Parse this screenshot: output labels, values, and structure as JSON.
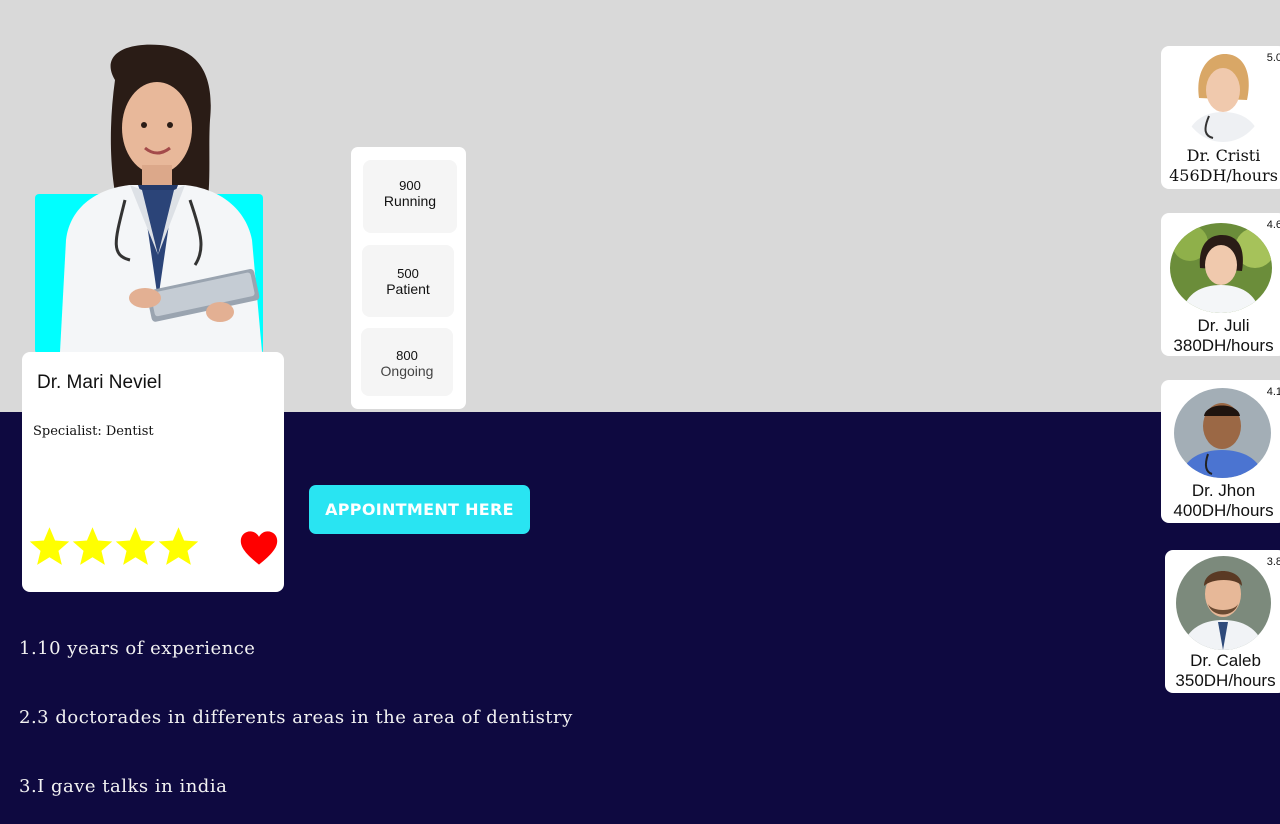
{
  "hero": {
    "name": "Dr. Mari Neviel",
    "specialist": "Specialist: Dentist",
    "stars": 4
  },
  "stats": [
    {
      "value": "900",
      "label": "Running"
    },
    {
      "value": "500",
      "label": "Patient"
    },
    {
      "value": "800",
      "label": "Ongoing"
    }
  ],
  "appointment_button": "APPOINTMENT HERE",
  "experience": [
    "1.10 years of experience",
    "2.3 doctorades in differents areas in the area of dentistry",
    "3.I gave talks in india"
  ],
  "doctors": [
    {
      "rating": "5.0",
      "name": "Dr. Cristi",
      "rate": "456DH/hours"
    },
    {
      "rating": "4.6",
      "name": "Dr. Juli",
      "rate": "380DH/hours"
    },
    {
      "rating": "4.1",
      "name": "Dr. Jhon",
      "rate": "400DH/hours"
    },
    {
      "rating": "3.8",
      "name": "Dr. Caleb",
      "rate": "350DH/hours"
    }
  ],
  "colors": {
    "top_background": "#d9d9d9",
    "bottom_background": "#0e0940",
    "accent_cyan": "#29e4f2",
    "hero_backdrop": "#00ffff",
    "star": "#ffff00",
    "heart": "#ff0000"
  }
}
